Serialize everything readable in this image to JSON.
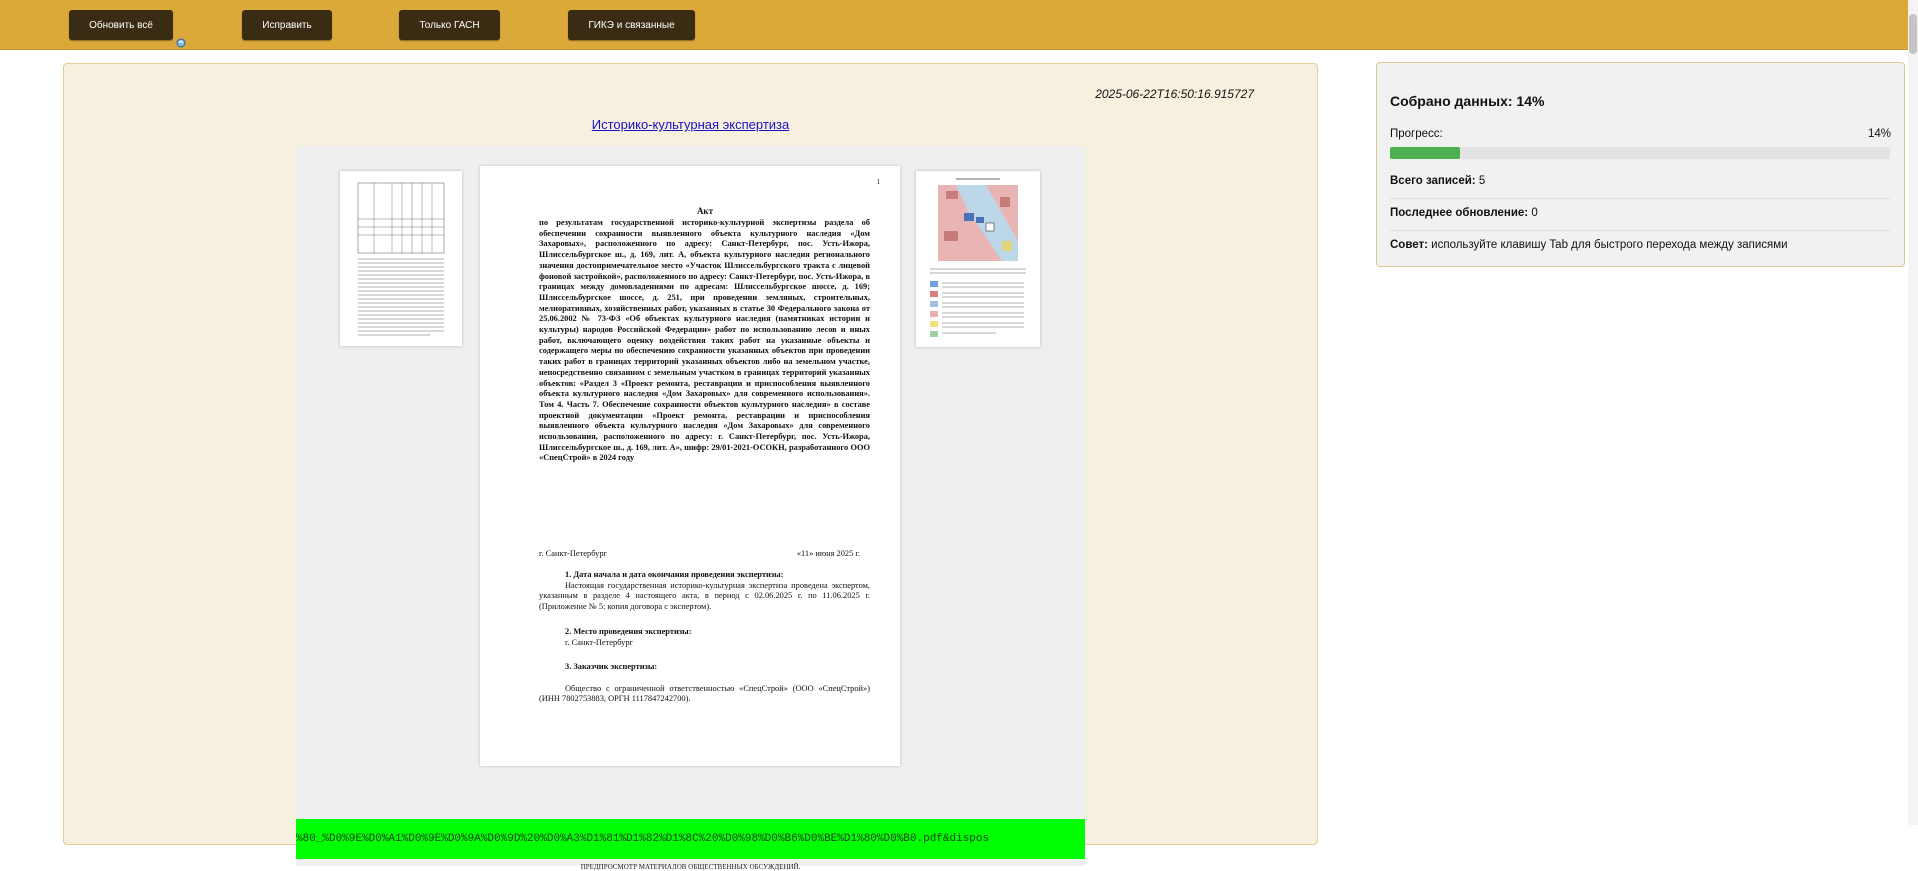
{
  "toolbar": {
    "buttons": [
      "Обновить всё",
      "Исправить",
      "Только ГАСН",
      "ГИКЭ и связанные"
    ],
    "bg_color": "#daa93a",
    "button_color": "#3a2c12"
  },
  "record": {
    "timestamp": "2025-06-22T16:50:16.915727",
    "link_text": "Историко-культурная экспертиза",
    "url_fragment": "%80_%D0%9E%D0%A1%D0%9E%D0%9A%D0%9D%20%D0%A3%D1%81%D1%82%D1%8C%20%D0%98%D0%B6%D0%BE%D1%80%D0%B0.pdf&dispos",
    "footnote": "ПРЕДПРОСМОТР МАТЕРИАЛОВ ОБЩЕСТВЕННЫХ ОБСУЖДЕНИЙ."
  },
  "pdf_page": {
    "page_number": "1",
    "title": "Акт",
    "body": "по результатам государственной историко-культурной экспертизы раздела об обеспечении сохранности выявленного объекта культурного наследия «Дом Захаровых», расположенного по адресу: Санкт-Петербург, пос. Усть-Ижора, Шлиссельбургское ш., д. 169, лит. А, объекта культурного наследия регионального значения достопримечательное место «Участок Шлиссельбургского тракта с лицевой фоновой застройкой», расположенного по адресу: Санкт-Петербург, пос. Усть-Ижора, в границах между домовладениями по адресам: Шлиссельбургское шоссе, д. 169; Шлиссельбургское шоссе, д. 251, при проведении земляных, строительных, мелиоративных, хозяйственных работ, указанных в статье 30 Федерального закона от 25.06.2002 № 73-ФЗ «Об объектах культурного наследия (памятниках истории и культуры) народов Российской Федерации» работ по использованию лесов и иных работ, включающего оценку воздействия таких работ на указанные объекты и содержащего меры по обеспечению сохранности указанных объектов при проведении таких работ в границах территорий указанных объектов либо на земельном участке, непосредственно связанном с земельным участком в границах территорий указанных объектов: «Раздел 3 «Проект ремонта, реставрации и приспособления выявленного объекта культурного наследия «Дом Захаровых» для современного использования». Том 4. Часть 7. Обеспечение сохранности объектов культурного наследия» в составе проектной документации «Проект ремонта, реставрации и приспособления выявленного объекта культурного наследия «Дом Захаровых» для современного использования, расположенного по адресу: г. Санкт-Петербург, пос. Усть-Ижора, Шлиссельбургское ш., д. 169, лит. А», шифр: 29/01-2021-ОСОКН, разработанного ООО «СпецСтрой» в 2024 году",
    "city": "г. Санкт-Петербург",
    "date": "«11» июня 2025 г.",
    "s1_heading": "1.  Дата начала и дата окончания проведения экспертизы:",
    "s1_text": "Настоящая государственная историко-культурная экспертиза проведена экспертом, указанным в разделе 4 настоящего акта, в период с 02.06.2025 г. по 11.06.2025 г. (Приложение № 5: копия договора с экспертом).",
    "s2_heading": "2.  Место проведения экспертизы:",
    "s2_text": "г. Санкт-Петербург",
    "s3_heading": "3.  Заказчик экспертизы:",
    "s3_text": "Общество с ограниченной ответственностью «СпецСтрой» (ООО «СпецСтрой») (ИНН 7802753883, ОРГН 1117847242700)."
  },
  "stats": {
    "title": "Собрано данных: 14%",
    "progress_label": "Прогресс:",
    "progress_value": "14%",
    "progress": 0.14,
    "total_label": "Всего записей:",
    "total_value": "5",
    "last_label": "Последнее обновление:",
    "last_value": "0",
    "tip_label": "Совет:",
    "tip_text": "используйте клавишу Tab для быстрого перехода между записями",
    "fill_color": "#4caf50"
  }
}
